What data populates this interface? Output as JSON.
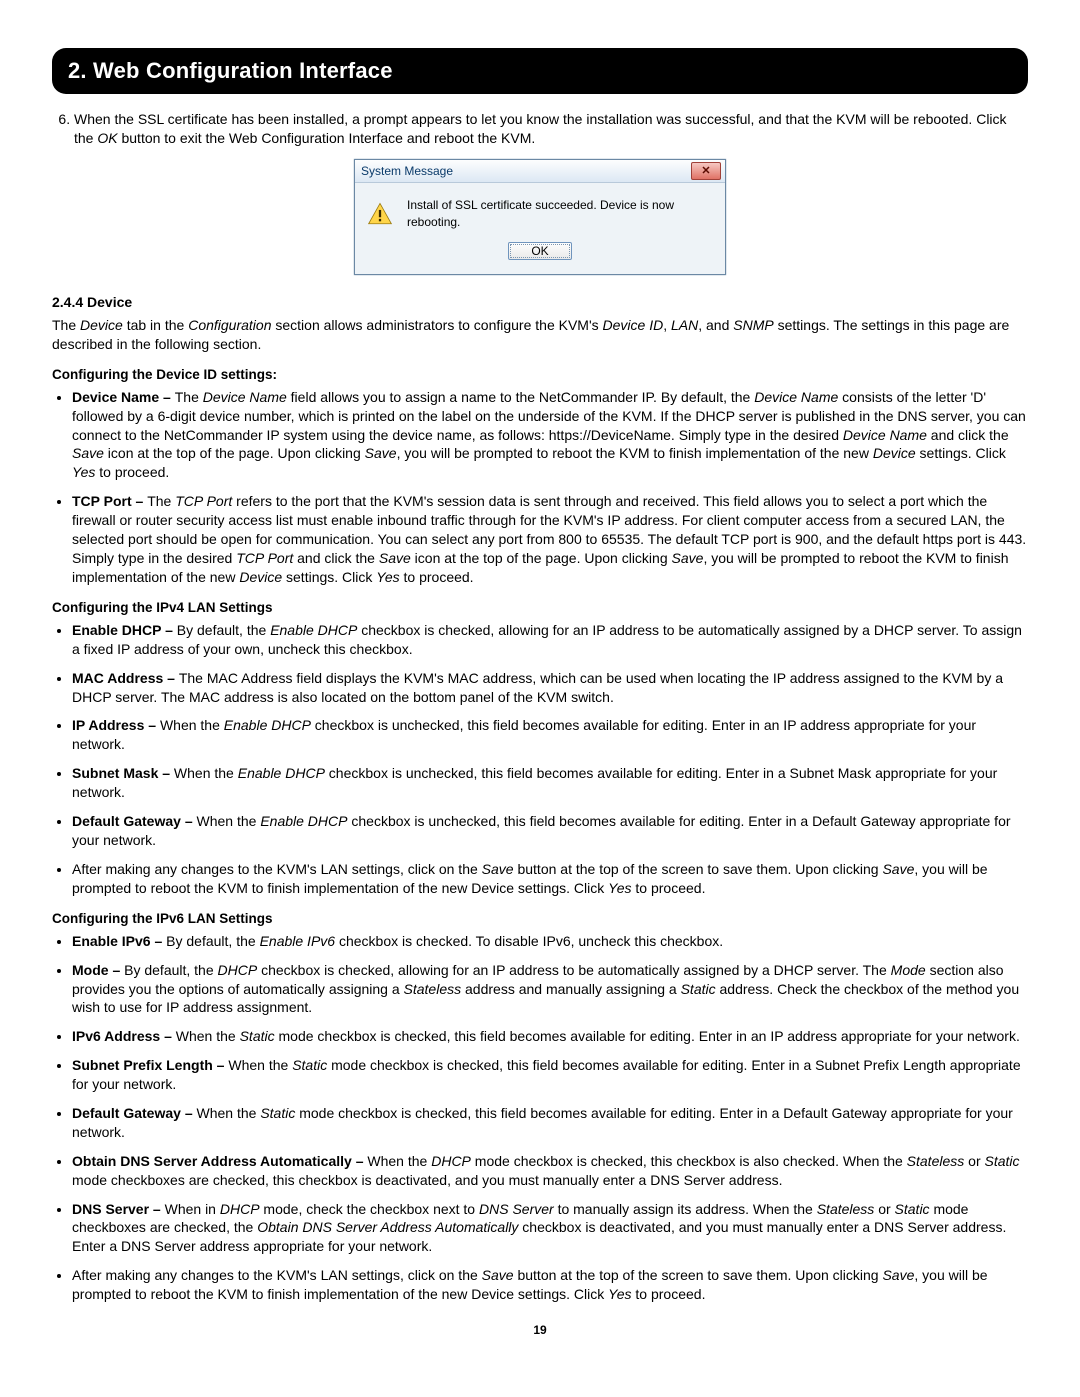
{
  "banner": "2. Web Configuration Interface",
  "step6": {
    "num": "6.",
    "text_parts": [
      "When the SSL certificate has been installed, a prompt appears to let you know the installation was successful, and that the KVM will be rebooted. Click the ",
      "OK",
      " button to exit the Web Configuration Interface and reboot the KVM."
    ]
  },
  "sysmsg": {
    "title": "System Message",
    "close_glyph": "✕",
    "body": "Install of SSL certificate succeeded. Device is now rebooting.",
    "ok_label": "OK"
  },
  "device_heading": "2.4.4 Device",
  "device_lead_parts": [
    "The ",
    "Device",
    " tab in the ",
    "Configuration",
    " section allows administrators to configure the KVM's ",
    "Device ID",
    ", ",
    "LAN",
    ", and ",
    "SNMP",
    " settings. The settings in this page are described in the following section."
  ],
  "cfg_id_heading": "Configuring the Device ID settings:",
  "cfg_id_items": [
    {
      "label": "Device Name – ",
      "body_parts": [
        "The ",
        "Device Name",
        " field allows you to assign a name to the NetCommander IP. By default, the ",
        "Device Name",
        " consists of the letter 'D' followed by a 6-digit device number, which is printed on the label on the underside of the KVM. If the DHCP server is published in the DNS server, you can connect to the NetCommander IP system using the device name, as follows: https://DeviceName. Simply type in the desired ",
        "Device Name",
        " and click the ",
        "Save",
        " icon at the top of the page. Upon clicking ",
        "Save",
        ", you will be prompted to reboot the KVM to finish implementation of the new ",
        "Device",
        " settings. Click ",
        "Yes",
        " to proceed."
      ]
    },
    {
      "label": "TCP Port – ",
      "body_parts": [
        "The ",
        "TCP Port",
        " refers to the port that the KVM's session data is sent through and received. This field allows you to select a port which the firewall or router security access list must enable inbound traffic through for the KVM's IP address. For client computer access from a secured LAN, the selected port should be open for communication. You can select any port from 800 to 65535. The default TCP port is 900, and the default https port is 443. Simply type in the desired ",
        "TCP Port",
        " and click the ",
        "Save",
        " icon at the top of the page. Upon clicking ",
        "Save",
        ", you will be prompted to reboot the KVM to finish implementation of the new ",
        "Device",
        " settings. Click ",
        "Yes",
        " to proceed."
      ]
    }
  ],
  "cfg_ipv4_heading": "Configuring the IPv4 LAN Settings",
  "cfg_ipv4_items": [
    {
      "label": "Enable DHCP – ",
      "body_parts": [
        "By default, the ",
        "Enable DHCP",
        " checkbox is checked, allowing for an IP address to be automatically assigned by a DHCP server. To assign a fixed IP address of your own, uncheck this checkbox."
      ]
    },
    {
      "label": "MAC Address – ",
      "body_parts": [
        "The MAC Address field displays the KVM's MAC address, which can be used when locating the IP address assigned to the KVM by a DHCP server. The MAC address is also located on the bottom panel of the KVM switch."
      ]
    },
    {
      "label": "IP Address – ",
      "body_parts": [
        "When the ",
        "Enable DHCP",
        " checkbox is unchecked, this field becomes available for editing. Enter in an IP address appropriate for your network."
      ]
    },
    {
      "label": "Subnet Mask – ",
      "body_parts": [
        "When the ",
        "Enable DHCP",
        " checkbox is unchecked, this field becomes available for editing. Enter in a Subnet Mask appropriate for your network."
      ]
    },
    {
      "label": "Default Gateway – ",
      "body_parts": [
        "When the ",
        "Enable DHCP",
        " checkbox is unchecked, this field becomes available for editing. Enter in a Default Gateway appropriate for your network."
      ]
    },
    {
      "label": "",
      "body_parts": [
        "After making any changes to the KVM's LAN settings, click on the ",
        "Save",
        " button at the top of the screen to save them. Upon clicking ",
        "Save",
        ", you will be prompted to reboot the KVM to finish implementation of the new Device settings. Click ",
        "Yes",
        " to proceed."
      ]
    }
  ],
  "cfg_ipv6_heading": "Configuring the IPv6 LAN Settings",
  "cfg_ipv6_items": [
    {
      "label": "Enable IPv6 – ",
      "body_parts": [
        "By default, the ",
        "Enable IPv6",
        " checkbox is checked. To disable IPv6, uncheck this checkbox."
      ]
    },
    {
      "label": "Mode – ",
      "body_parts": [
        "By default, the ",
        "DHCP",
        " checkbox is checked, allowing for an IP address to be automatically assigned by a DHCP server. The ",
        "Mode",
        " section also provides you the options of automatically assigning a ",
        "Stateless",
        " address and manually assigning a ",
        "Static",
        " address. Check the checkbox of the method you wish to use for IP address assignment."
      ]
    },
    {
      "label": "IPv6 Address – ",
      "body_parts": [
        "When the ",
        "Static",
        " mode checkbox is checked, this field becomes available for editing. Enter in an IP address appropriate for your network."
      ]
    },
    {
      "label": "Subnet Prefix Length – ",
      "body_parts": [
        "When the ",
        "Static",
        " mode checkbox is checked, this field becomes available for editing. Enter in a Subnet Prefix Length appropriate for your network."
      ]
    },
    {
      "label": "Default Gateway – ",
      "body_parts": [
        "When the ",
        "Static",
        " mode checkbox is checked, this field becomes available for editing. Enter in a Default Gateway appropriate for your network."
      ]
    },
    {
      "label": "Obtain DNS Server Address Automatically – ",
      "body_parts": [
        "When the ",
        "DHCP",
        " mode checkbox is checked, this checkbox is also checked. When the ",
        "Stateless",
        " or ",
        "Static",
        " mode checkboxes are checked, this checkbox is deactivated, and you must manually enter a DNS Server address."
      ]
    },
    {
      "label": "DNS Server – ",
      "body_parts": [
        "When in ",
        "DHCP",
        " mode, check the checkbox next to ",
        "DNS Server",
        " to manually assign its address. When the ",
        "Stateless",
        " or ",
        "Static",
        " mode checkboxes are checked, the ",
        "Obtain DNS Server Address Automatically",
        " checkbox is deactivated, and you must manually enter a DNS Server address. Enter a DNS Server address appropriate for your network."
      ]
    },
    {
      "label": "",
      "body_parts": [
        "After making any changes to the KVM's LAN settings, click on the ",
        "Save",
        " button at the top of the screen to save them. Upon clicking ",
        "Save",
        ", you will be prompted to reboot the KVM to finish implementation of the new Device settings. Click ",
        "Yes",
        " to proceed."
      ]
    }
  ],
  "page_number": "19"
}
